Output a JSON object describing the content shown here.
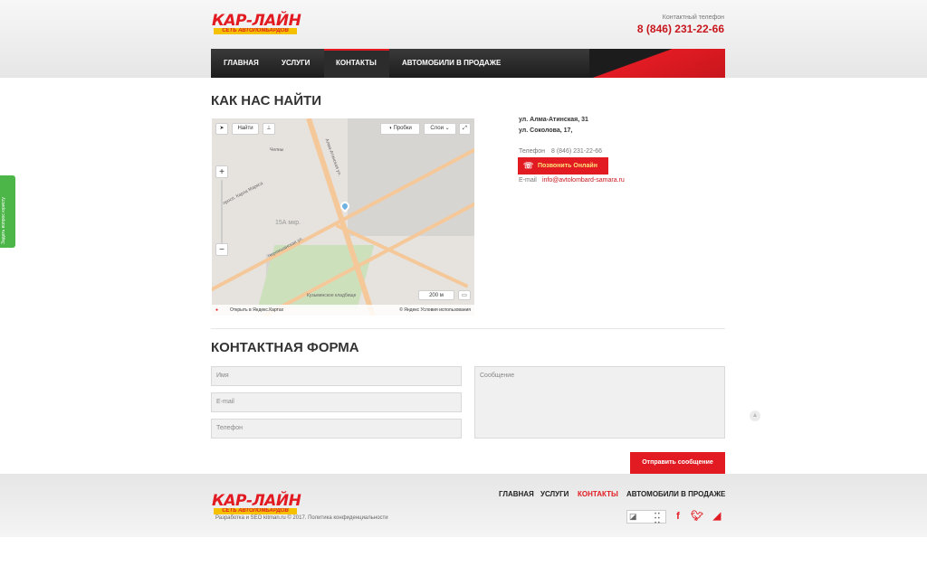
{
  "header": {
    "logo_text": "КАР-ЛАЙН",
    "logo_tagline": "СЕТЬ АВТОЛОМБАРДОВ",
    "phone_label": "Контактный телефон",
    "phone_number": "8 (846) 231-22-66"
  },
  "nav": [
    {
      "label": "ГЛАВНАЯ",
      "active": false
    },
    {
      "label": "УСЛУГИ",
      "active": false
    },
    {
      "label": "КОНТАКТЫ",
      "active": true
    },
    {
      "label": "АВТОМОБИЛИ В ПРОДАЖЕ",
      "active": false
    }
  ],
  "page_title": "КАК НАС НАЙТИ",
  "map": {
    "find_label": "Найти",
    "traffic_label": "Пробки",
    "layers_label": "Слои",
    "open_label": "Открыть в Яндекс.Картах",
    "copyright": "© Яндекс Условия использования",
    "scale_label": "200 м",
    "labels": [
      "Алма-Атинская ул.",
      "просп. Карла Маркса",
      "Черемшанская ул.",
      "15А мкр.",
      "Кузьминское кладбище",
      "Челны"
    ]
  },
  "contacts": {
    "address_1": "ул. Алма-Атинская, 31",
    "address_2": "ул. Соколова, 17,",
    "phone_label": "Телефон",
    "phone_value": "8 (846) 231-22-66",
    "call_button": "Позвонить Онлайн",
    "email_label": "E-mail",
    "email_value": "info@avtolombard-samara.ru"
  },
  "form": {
    "title": "КОНТАКТНАЯ ФОРМА",
    "name_placeholder": "Имя",
    "email_placeholder": "E-mail",
    "phone_placeholder": "Телефон",
    "message_placeholder": "Сообщение",
    "submit_label": "Отправить сообщение"
  },
  "side_tab": {
    "label": "Задать вопрос юристу"
  },
  "footer": {
    "logo_text": "КАР-ЛАЙН",
    "logo_tagline": "СЕТЬ АВТОЛОМБАРДОВ",
    "copyright": "Разработка и SEO kitman.ru © 2017. Политика конфиденциальности",
    "nav": [
      {
        "label": "ГЛАВНАЯ",
        "active": false
      },
      {
        "label": "УСЛУГИ",
        "active": false
      },
      {
        "label": "КОНТАКТЫ",
        "active": true
      },
      {
        "label": "АВТОМОБИЛИ В ПРОДАЖЕ",
        "active": false
      }
    ],
    "social_icons": [
      "facebook-icon",
      "twitter-icon",
      "rss-icon"
    ]
  },
  "colors": {
    "brand_red": "#e21b23",
    "dark_nav": "#1c1c1c",
    "logo_yellow": "#f4c000"
  }
}
